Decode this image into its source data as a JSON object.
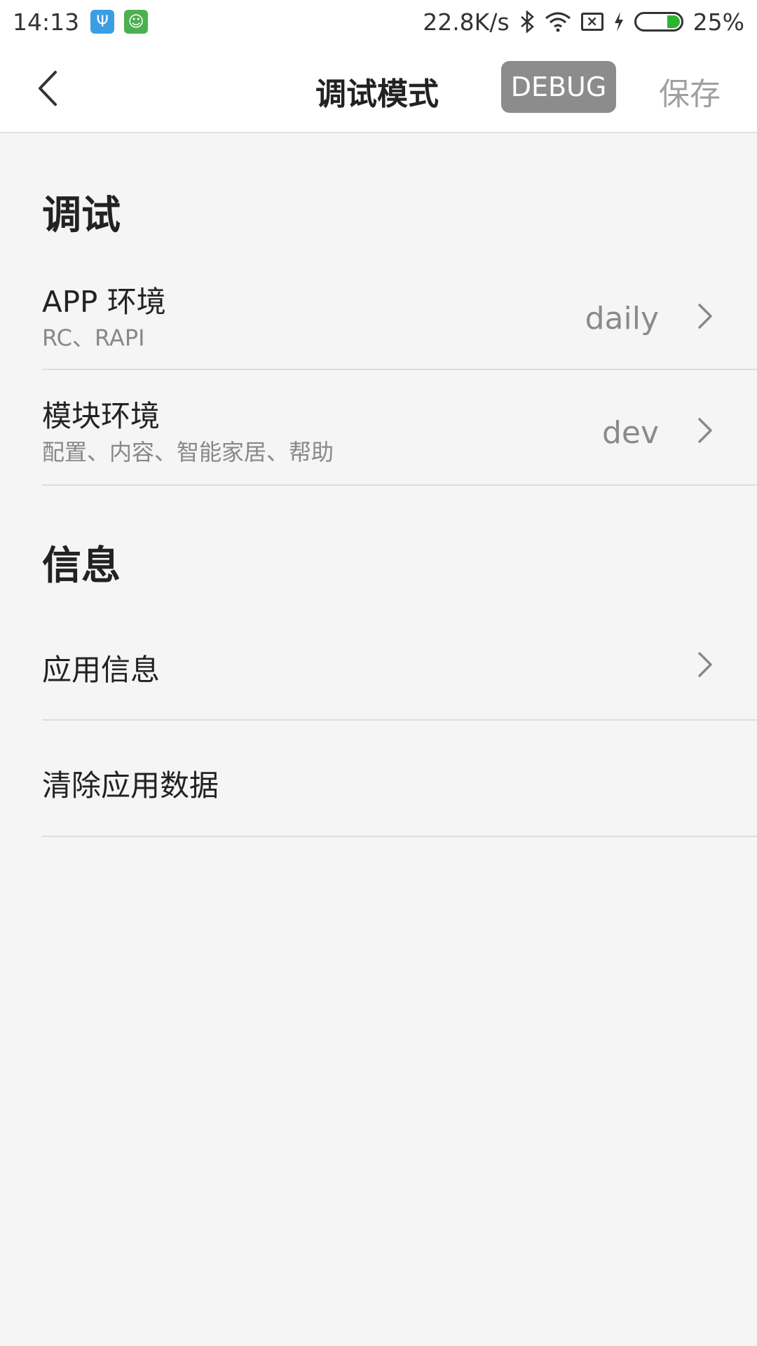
{
  "status_bar": {
    "time": "14:13",
    "network_speed": "22.8K/s",
    "battery_percent": "25%",
    "battery_level": 0.25,
    "icons": [
      "usb-icon",
      "android-notification-icon",
      "bluetooth-icon",
      "wifi-icon",
      "no-sim-icon",
      "charging-icon",
      "battery-icon"
    ]
  },
  "header": {
    "title": "调试模式",
    "debug_badge": "DEBUG",
    "save_label": "保存"
  },
  "sections": [
    {
      "title": "调试",
      "items": [
        {
          "label": "APP 环境",
          "sub": "RC、RAPI",
          "value": "daily"
        },
        {
          "label": "模块环境",
          "sub": "配置、内容、智能家居、帮助",
          "value": "dev"
        }
      ]
    },
    {
      "title": "信息",
      "items": [
        {
          "label": "应用信息"
        },
        {
          "label": "清除应用数据"
        }
      ]
    }
  ],
  "colors": {
    "accent_badge": "#8c8c8c",
    "battery_fill": "#2db52d",
    "usb_icon": "#3a9ee4",
    "android_icon": "#4caf50",
    "background": "#f5f5f5"
  }
}
